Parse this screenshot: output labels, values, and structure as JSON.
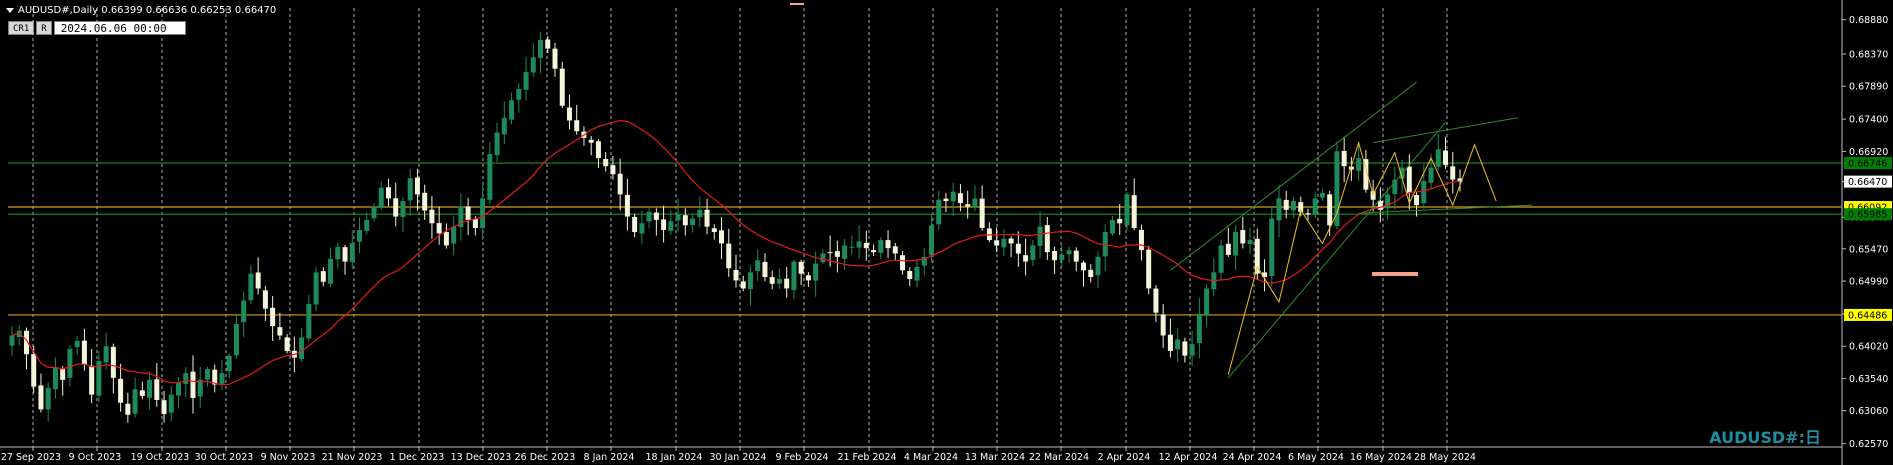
{
  "header": {
    "symbol": "AUDUSD#,Daily",
    "open": "0.66399",
    "high": "0.66636",
    "low": "0.66253",
    "close": "0.66470"
  },
  "toolbar": {
    "cursor_mode_label": "CR1",
    "r_label": "R",
    "date_value": "2024.06.06 00:00"
  },
  "watermark": "AUDUSD#:日",
  "colors": {
    "background": "#000000",
    "bull_candle": "#1e8c5a",
    "bear_candle": "#f5f5dc",
    "moving_average": "#e41b1b",
    "horizontal_yellow": "#d4a017",
    "horizontal_green": "#228b22",
    "trendline": "#2e8b2e",
    "wave": "#f0c020",
    "label_box": "#ffffff"
  },
  "chart_data": {
    "type": "candlestick",
    "y_axis_ticks": [
      "0.68880",
      "0.68370",
      "0.67890",
      "0.67400",
      "0.66920",
      "0.66470",
      "0.65940",
      "0.65470",
      "0.64990",
      "0.64500",
      "0.64020",
      "0.63540",
      "0.63060",
      "0.62570"
    ],
    "ylim": [
      0.6255,
      0.6892
    ],
    "x_axis_ticks": [
      "27 Sep 2023",
      "9 Oct 2023",
      "19 Oct 2023",
      "30 Oct 2023",
      "9 Nov 2023",
      "21 Nov 2023",
      "1 Dec 2023",
      "13 Dec 2023",
      "26 Dec 2023",
      "8 Jan 2024",
      "18 Jan 2024",
      "30 Jan 2024",
      "9 Feb 2024",
      "21 Feb 2024",
      "4 Mar 2024",
      "13 Mar 2024",
      "22 Mar 2024",
      "2 Apr 2024",
      "12 Apr 2024",
      "24 Apr 2024",
      "6 May 2024",
      "16 May 2024",
      "28 May 2024"
    ],
    "horizontal_levels": [
      {
        "label": "0.66746",
        "value": 0.66746,
        "color": "green"
      },
      {
        "label": "0.66470",
        "value": 0.6647,
        "color": "current"
      },
      {
        "label": "0.66092",
        "value": 0.66092,
        "color": "yellow"
      },
      {
        "label": "0.65985",
        "value": 0.65985,
        "color": "green"
      },
      {
        "label": "0.64486",
        "value": 0.64486,
        "color": "yellow"
      }
    ],
    "closes": [
      0.6418,
      0.6425,
      0.639,
      0.6342,
      0.6308,
      0.634,
      0.637,
      0.6352,
      0.6398,
      0.641,
      0.6375,
      0.633,
      0.638,
      0.6402,
      0.6355,
      0.6318,
      0.63,
      0.6338,
      0.6328,
      0.6352,
      0.6322,
      0.6301,
      0.633,
      0.6348,
      0.6362,
      0.6325,
      0.6352,
      0.6368,
      0.6345,
      0.6362,
      0.6388,
      0.6435,
      0.647,
      0.651,
      0.6488,
      0.6458,
      0.6432,
      0.6418,
      0.6395,
      0.6385,
      0.6415,
      0.6465,
      0.6512,
      0.6498,
      0.6532,
      0.655,
      0.6528,
      0.6555,
      0.6575,
      0.659,
      0.661,
      0.6638,
      0.6622,
      0.6595,
      0.6618,
      0.6652,
      0.6628,
      0.6604,
      0.6585,
      0.657,
      0.6552,
      0.658,
      0.661,
      0.659,
      0.6578,
      0.6622,
      0.6688,
      0.672,
      0.6742,
      0.6768,
      0.6785,
      0.681,
      0.6832,
      0.6858,
      0.6845,
      0.6815,
      0.676,
      0.6738,
      0.6722,
      0.6712,
      0.6705,
      0.6682,
      0.667,
      0.6658,
      0.6628,
      0.6595,
      0.6572,
      0.6585,
      0.6602,
      0.659,
      0.6575,
      0.6588,
      0.6598,
      0.6582,
      0.6592,
      0.6605,
      0.658,
      0.6572,
      0.6555,
      0.6518,
      0.65,
      0.6488,
      0.6512,
      0.653,
      0.6505,
      0.6495,
      0.6502,
      0.6488,
      0.6528,
      0.651,
      0.65,
      0.6525,
      0.654,
      0.6542,
      0.6535,
      0.6552,
      0.655,
      0.6558,
      0.6548,
      0.6542,
      0.656,
      0.6548,
      0.654,
      0.6515,
      0.6502,
      0.652,
      0.6535,
      0.6582,
      0.662,
      0.6618,
      0.6632,
      0.6615,
      0.661,
      0.6622,
      0.6578,
      0.656,
      0.6552,
      0.6562,
      0.6555,
      0.654,
      0.6528,
      0.6552,
      0.658,
      0.6542,
      0.653,
      0.6538,
      0.6545,
      0.6528,
      0.6515,
      0.6505,
      0.6535,
      0.6572,
      0.659,
      0.6585,
      0.6628,
      0.6578,
      0.6545,
      0.6488,
      0.6452,
      0.6418,
      0.6395,
      0.6412,
      0.6388,
      0.6405,
      0.645,
      0.6488,
      0.6512,
      0.6552,
      0.6538,
      0.6572,
      0.6555,
      0.656,
      0.651,
      0.6505,
      0.6592,
      0.6622,
      0.6605,
      0.6618,
      0.6602,
      0.6598,
      0.6622,
      0.663,
      0.6582,
      0.6692,
      0.667,
      0.6665,
      0.6682,
      0.6635,
      0.662,
      0.6605,
      0.6628,
      0.665,
      0.6668,
      0.663,
      0.6612,
      0.6648,
      0.6668,
      0.6695,
      0.6672,
      0.665,
      0.6647
    ]
  }
}
